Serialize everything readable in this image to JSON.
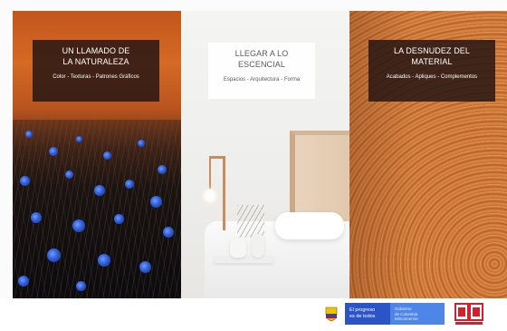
{
  "panels": [
    {
      "title_line1": "UN LLAMADO DE",
      "title_line2": "LA NATURALEZA",
      "subtitle": "Color - Texturas - Patrones Gráficos"
    },
    {
      "title_line1": "LLEGAR A LO",
      "title_line2": "ESCENCIAL",
      "subtitle": "Espacios - Arquitectura - Forma"
    },
    {
      "title_line1": "LA DESNUDEZ DEL",
      "title_line2": "MATERIAL",
      "subtitle": "Acabados - Apliques - Complementos"
    }
  ],
  "footer": {
    "gov_line1": "El progreso",
    "gov_line2": "es de todos",
    "ministry_line1": "Gobierno",
    "ministry_line2": "de Colombia",
    "ministry_line3": "Mincomercio"
  },
  "colors": {
    "caption_dark": "#28161480",
    "gov_blue": "#2b54c8",
    "gov_light_blue": "#4d86e8",
    "logo_red": "#d2202f"
  }
}
